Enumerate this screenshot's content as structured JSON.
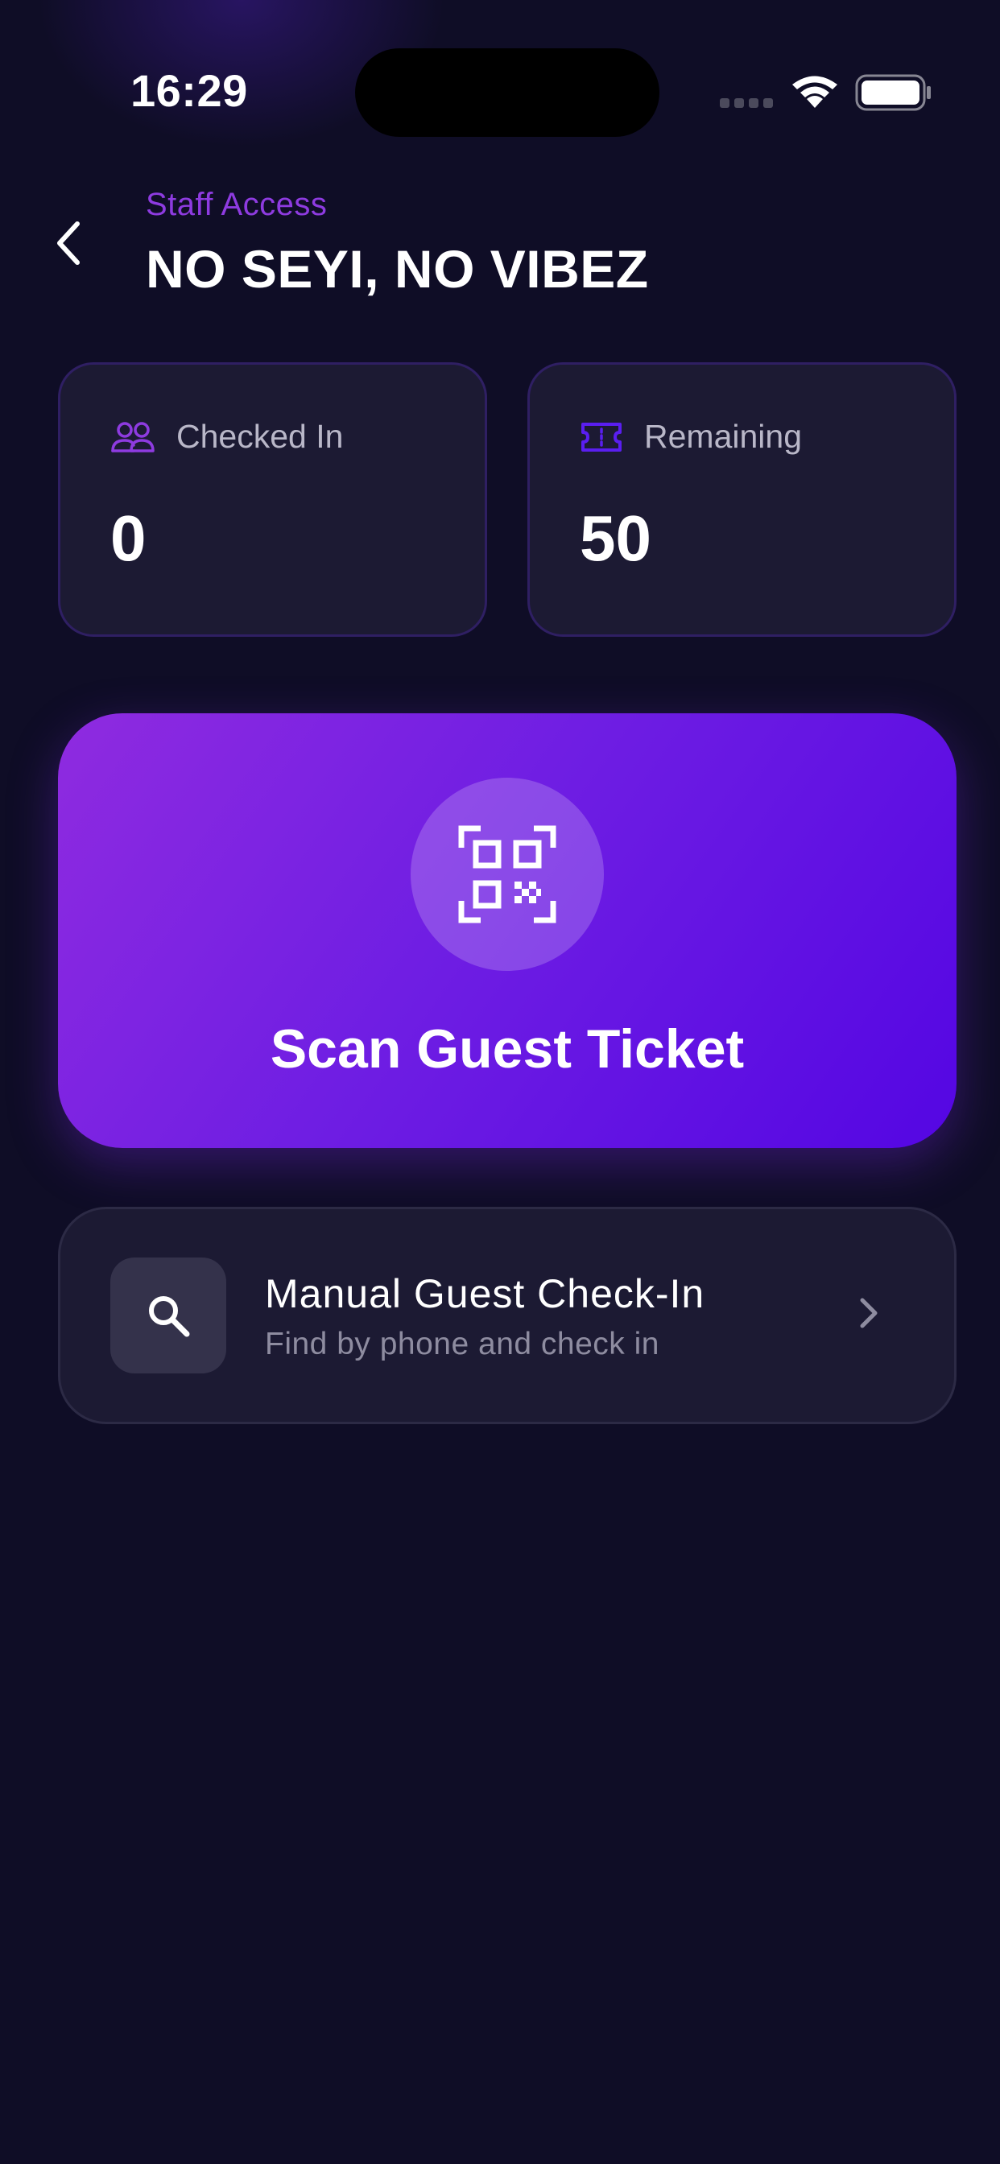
{
  "status_bar": {
    "time": "16:29"
  },
  "header": {
    "subtitle": "Staff Access",
    "title": "NO SEYI, NO VIBEZ"
  },
  "stats": [
    {
      "label": "Checked In",
      "value": "0",
      "icon": "people-icon"
    },
    {
      "label": "Remaining",
      "value": "50",
      "icon": "ticket-icon"
    }
  ],
  "scan": {
    "label": "Scan Guest Ticket",
    "icon": "qr-code-icon"
  },
  "manual": {
    "title": "Manual Guest Check-In",
    "subtitle": "Find by phone and check in",
    "icon": "search-icon"
  },
  "colors": {
    "background": "#0f0d26",
    "accent": "#8e3be0",
    "card": "#1c1a33",
    "gradient_start": "#8f2be0",
    "gradient_end": "#5406e3"
  }
}
